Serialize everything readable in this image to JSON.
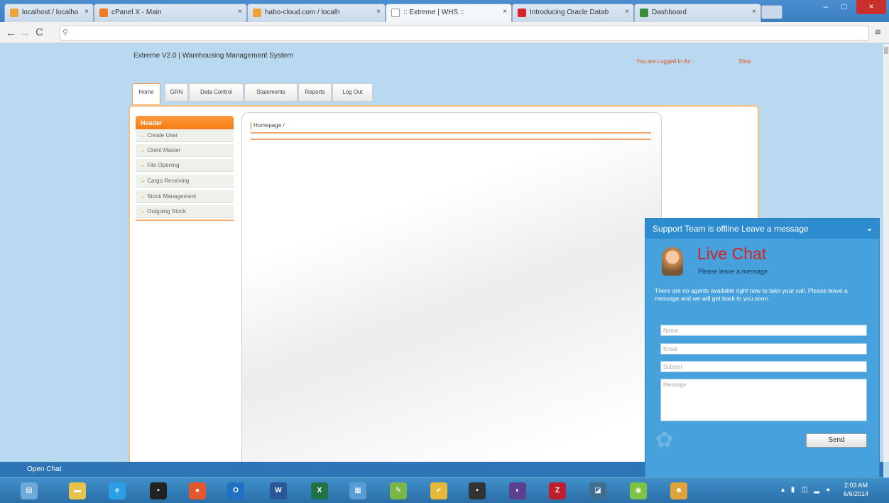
{
  "browser": {
    "tabs": [
      {
        "label": "localhost / localhost | phy",
        "favicon_color": "#f2a23a",
        "active": false
      },
      {
        "label": "cPanel X - Main",
        "favicon_color": "#f07a24",
        "active": false
      },
      {
        "label": "habo-cloud.com / localh",
        "favicon_color": "#f2a23a",
        "active": false
      },
      {
        "label": ":: Extreme | WHS ::",
        "favicon_color": "#ffffff",
        "active": true
      },
      {
        "label": "Introducing Oracle Datab",
        "favicon_color": "#d6252b",
        "active": false
      },
      {
        "label": "Dashboard",
        "favicon_color": "#3a8f3a",
        "active": false
      }
    ],
    "close_glyph": "×",
    "address_placeholder": "",
    "window_controls": {
      "minimize": "–",
      "maximize": "□",
      "close": "×"
    }
  },
  "app": {
    "title": "Extreme V2.0 | Warehousing Management System",
    "logged_in_label": "You are Logged In As :",
    "logged_in_user": "Shiw",
    "nav_tabs": [
      "Home",
      "GRN",
      "Data Control",
      "Statements",
      "Reports",
      "Log Out"
    ],
    "sidebar": {
      "header": "Header",
      "items": [
        "Create User",
        "Client Master",
        "File Opening",
        "Cargo Receiving",
        "Stock Management",
        "Outgoing Stock"
      ]
    },
    "breadcrumb": "Homepage /",
    "accent_color": "#f47c12"
  },
  "chat": {
    "header": "Support Team is offline Leave a message",
    "brand": "Live Chat",
    "subtitle": "Please leave a message",
    "message": "There are no agents available right now to take your call. Please leave a message and we will get back to you soon.",
    "fields": {
      "name": "Name",
      "email": "Email",
      "subject": "Subject",
      "message": "Message"
    },
    "send_label": "Send",
    "open_chat_label": "Open Chat",
    "header_color": "#2d8ccf"
  },
  "taskbar": {
    "apps": [
      {
        "name": "windows-explorer-icon",
        "glyph": "▤",
        "color": "#6fa9d9"
      },
      {
        "name": "file-explorer-icon",
        "glyph": "▬",
        "color": "#e8c34c"
      },
      {
        "name": "internet-explorer-icon",
        "glyph": "e",
        "color": "#2a9fe6"
      },
      {
        "name": "command-prompt-icon",
        "glyph": "▪",
        "color": "#222222"
      },
      {
        "name": "chrome-icon",
        "glyph": "●",
        "color": "#e2572b"
      },
      {
        "name": "outlook-icon",
        "glyph": "O",
        "color": "#1f71c4"
      },
      {
        "name": "word-icon",
        "glyph": "W",
        "color": "#2b579a"
      },
      {
        "name": "excel-icon",
        "glyph": "X",
        "color": "#217346"
      },
      {
        "name": "network-icon",
        "glyph": "▦",
        "color": "#5a9bd5"
      },
      {
        "name": "paint-icon",
        "glyph": "✎",
        "color": "#7ab648"
      },
      {
        "name": "tasks-icon",
        "glyph": "✔",
        "color": "#e6b83a"
      },
      {
        "name": "terminal-icon",
        "glyph": "▪",
        "color": "#333333"
      },
      {
        "name": "eclipse-icon",
        "glyph": "◐",
        "color": "#5d3f8f"
      },
      {
        "name": "filezilla-icon",
        "glyph": "Z",
        "color": "#bf1e2e"
      },
      {
        "name": "sql-tool-icon",
        "glyph": "◪",
        "color": "#3f6e8f"
      },
      {
        "name": "feed-icon",
        "glyph": "◉",
        "color": "#7cc243"
      },
      {
        "name": "users-icon",
        "glyph": "☻",
        "color": "#e0a23a"
      }
    ],
    "tray": "▴ ▮ ◫ ▂ ◂",
    "clock_time": "2:03 AM",
    "clock_date": "6/6/2014"
  }
}
